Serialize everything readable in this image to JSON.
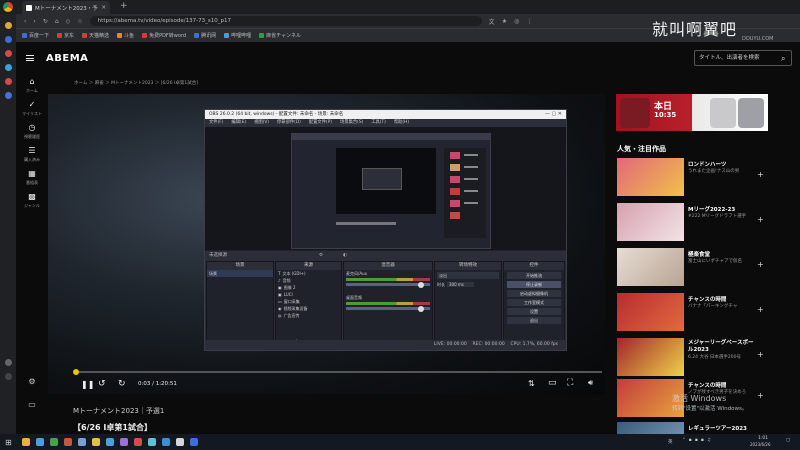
{
  "browser": {
    "tab_title": "Mトーナメント2023・予選",
    "url": "https://abema.tv/video/episode/137-73_s10_p17",
    "bookmarks": [
      {
        "label": "百度一下",
        "color": "#3b6fd6"
      },
      {
        "label": "京东",
        "color": "#d63b3b"
      },
      {
        "label": "天猫精选",
        "color": "#d63b3b"
      },
      {
        "label": "斗鱼",
        "color": "#e08a2b"
      },
      {
        "label": "免费PDF转word",
        "color": "#d63b3b"
      },
      {
        "label": "腾讯网",
        "color": "#3b6fd6"
      },
      {
        "label": "哔哩哔哩",
        "color": "#3ba1d6"
      },
      {
        "label": "麻雀チャンネル",
        "color": "#2b9e4b"
      }
    ]
  },
  "watermark": {
    "text": "就叫啊翼吧",
    "sub": "DOUYU.COM"
  },
  "header": {
    "logo": "ABEMA",
    "search_placeholder": "タイトル、出演者を検索"
  },
  "nav": [
    {
      "label": "ホーム",
      "icon": "home-icon"
    },
    {
      "label": "マイリスト",
      "icon": "check-icon"
    },
    {
      "label": "視聴履歴",
      "icon": "history-icon"
    },
    {
      "label": "購入済み",
      "icon": "purchase-icon"
    },
    {
      "label": "番組表",
      "icon": "schedule-icon"
    },
    {
      "label": "ジャンル",
      "icon": "genre-icon"
    }
  ],
  "breadcrumb": "ホーム ＞ 麻雀 ＞ Mトーナメント2023 ＞ [6/26 I卓第1試合]",
  "obs": {
    "title": "OBS 26.0.2 (64 bit, windows) - 配置文件: 未命名 - 场景: 未命名",
    "menu": [
      "文件(F)",
      "编辑(E)",
      "视图(V)",
      "停靠部件(D)",
      "配置文件(P)",
      "场景集合(S)",
      "工具(T)",
      "帮助(H)"
    ],
    "scene_bar": "未选择源",
    "docks": {
      "scenes": {
        "title": "场景",
        "items": [
          "场景"
        ]
      },
      "sources": {
        "title": "来源",
        "items": [
          "文本 (GDI+)",
          "音频",
          "图像 2",
          "LUCI",
          "窗口采集",
          "视频采集设备",
          "广告宣传"
        ]
      },
      "mixer": {
        "title": "混音器",
        "channels": [
          {
            "name": "麦克风/Aux"
          },
          {
            "name": "桌面音频"
          }
        ]
      },
      "transitions": {
        "title": "转场特效",
        "type": "淡出",
        "duration_label": "时长",
        "duration": "300 ms"
      },
      "controls": {
        "title": "控件",
        "buttons": [
          "开始推流",
          "停止录制",
          "启动虚拟摄像机",
          "工作室模式",
          "设置",
          "退出"
        ]
      }
    },
    "status": "LIVE: 00:00:00    REC: 00:00:00    CPU: 1.7%, 60.00 fps"
  },
  "player": {
    "time": "0:03 / 1:20:51"
  },
  "video": {
    "series": "Mトーナメント2023｜予選1",
    "episode": "【6/26 I卓第1試合】"
  },
  "sidebar": {
    "banner_text": "本日",
    "banner_sub": "10:35",
    "section_title": "人気・注目作品",
    "items": [
      {
        "name": "ロンドンハーツ",
        "desc": "うれまた企画!ナス山の男",
        "color": "#d94a55"
      },
      {
        "name": "Mリーグ2022-23",
        "desc": "#222 Mリーグドラフト選手",
        "color": "#c98f9c"
      },
      {
        "name": "極楽食堂",
        "desc": "富士山にいずチャアで仮名",
        "color": "#cbb9a9"
      },
      {
        "name": "チャンスの時間",
        "desc": "バナナ「パーキングチャ",
        "color": "#c73a3a"
      },
      {
        "name": "メジャーリーグベースボール2023",
        "desc": "6.24 大谷 日本選手200号",
        "color": "#b53135"
      },
      {
        "name": "チャンスの時間",
        "desc": "ノブが残すべき男子を決めろ",
        "color": "#c04a46"
      },
      {
        "name": "レギュラーツアー2023",
        "desc": "",
        "color": "#4a6c8a"
      }
    ]
  },
  "windows_notice": {
    "title": "激活 Windows",
    "sub": "转到\"设置\"以激活 Windows。"
  },
  "taskbar": {
    "time": "1:01",
    "date": "2023/6/26",
    "lang": "英",
    "apps": [
      "#e8b23a",
      "#4a9ee0",
      "#45a34f",
      "#c7583f",
      "#7a9fd6",
      "#e0c04a",
      "#4aa0d8",
      "#9c6fd6",
      "#d64a4a",
      "#5ec1d6",
      "#3b8fd6",
      "#d6d6d6",
      "#3d6fd6"
    ]
  }
}
